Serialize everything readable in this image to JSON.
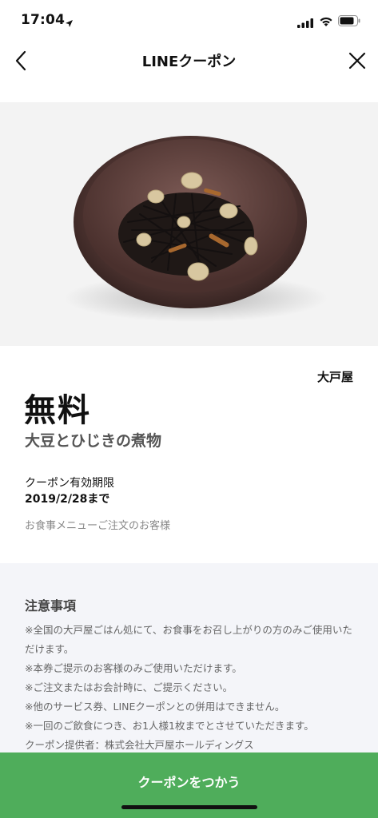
{
  "status": {
    "time": "17:04"
  },
  "nav": {
    "title": "LINEクーポン"
  },
  "coupon": {
    "merchant": "大戸屋",
    "price": "無料",
    "item": "大豆とひじきの煮物",
    "expiry_label": "クーポン有効期限",
    "expiry_date": "2019/2/28まで",
    "target": "お食事メニューご注文のお客様"
  },
  "notes": {
    "title": "注意事項",
    "lines": [
      "※全国の大戸屋ごはん処にて、お食事をお召し上がりの方のみご使用いただけます。",
      "※本券ご提示のお客様のみご使用いただけます。",
      "※ご注文またはお会計時に、ご提示ください。",
      "※他のサービス券、LINEクーポンとの併用はできません。",
      "※一回のご飲食につき、お1人様1枚までとさせていただきます。",
      "クーポン提供者：株式会社大戸屋ホールディングス"
    ]
  },
  "cta": {
    "label": "クーポンをつかう"
  },
  "colors": {
    "accent": "#4fad5b",
    "notes_bg": "#f4f5f9"
  },
  "icons": [
    "location-arrow-icon",
    "signal-icon",
    "wifi-icon",
    "battery-icon",
    "back-icon",
    "close-icon"
  ]
}
